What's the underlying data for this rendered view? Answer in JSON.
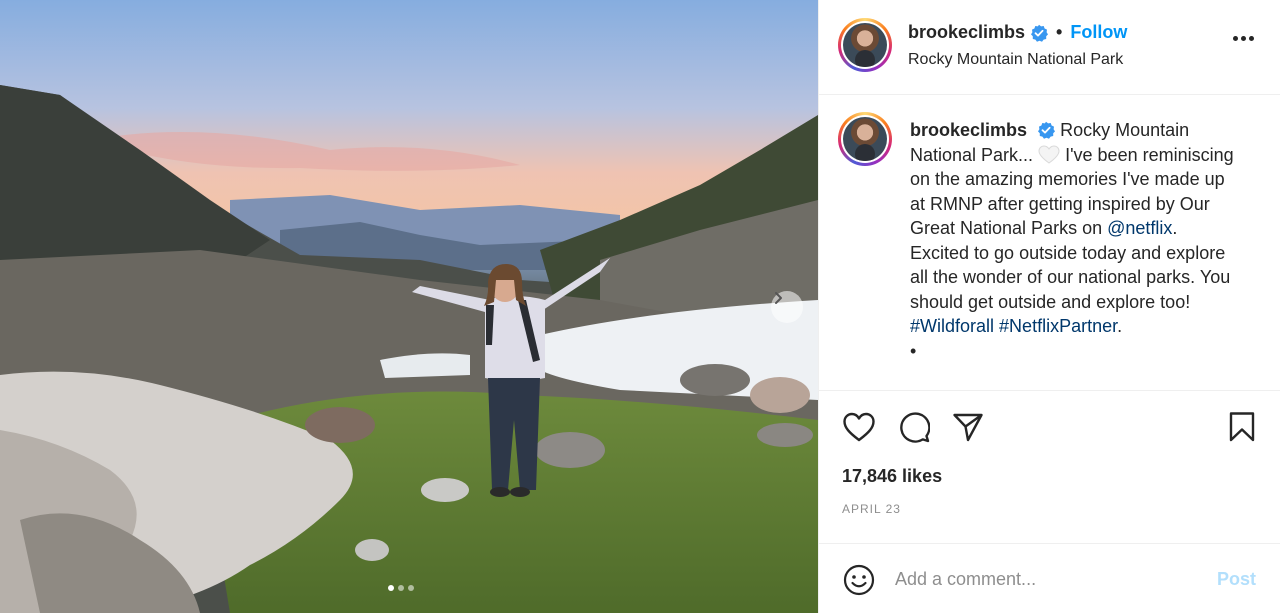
{
  "post": {
    "username": "brookeclimbs",
    "verified": true,
    "separator": "•",
    "follow_label": "Follow",
    "location": "Rocky Mountain National Park",
    "caption": {
      "username": "brookeclimbs",
      "text_1": "Rocky Mountain National Park...",
      "text_2": "I've been reminiscing on the amazing memories I've made up at RMNP after getting inspired by Our Great National Parks on",
      "mention": "@netflix",
      "text_3": ". Excited to go outside today and explore all the wonder of our national parks. You should get outside and explore too!",
      "hashtag_1": "#Wildforall",
      "hashtag_2": "#NetflixPartner",
      "text_4": ".",
      "trailing": "•"
    },
    "likes": "17,846 likes",
    "date": "APRIL 23"
  },
  "carousel": {
    "slide_count": 3,
    "current_slide": 1
  },
  "comment": {
    "placeholder": "Add a comment...",
    "post_label": "Post"
  },
  "icons": {
    "verified": "verified-badge-icon",
    "more": "more-options-icon",
    "like": "heart-icon",
    "comment": "comment-icon",
    "share": "paper-plane-icon",
    "save": "bookmark-icon",
    "emoji": "smiley-icon",
    "next": "chevron-right-icon",
    "caption_emoji": "white-heart-emoji"
  },
  "colors": {
    "accent": "#0095f6",
    "link": "#00376b",
    "muted": "#8e8e8e",
    "post_disabled": "#b2dffc",
    "verified": "#3897f0"
  }
}
